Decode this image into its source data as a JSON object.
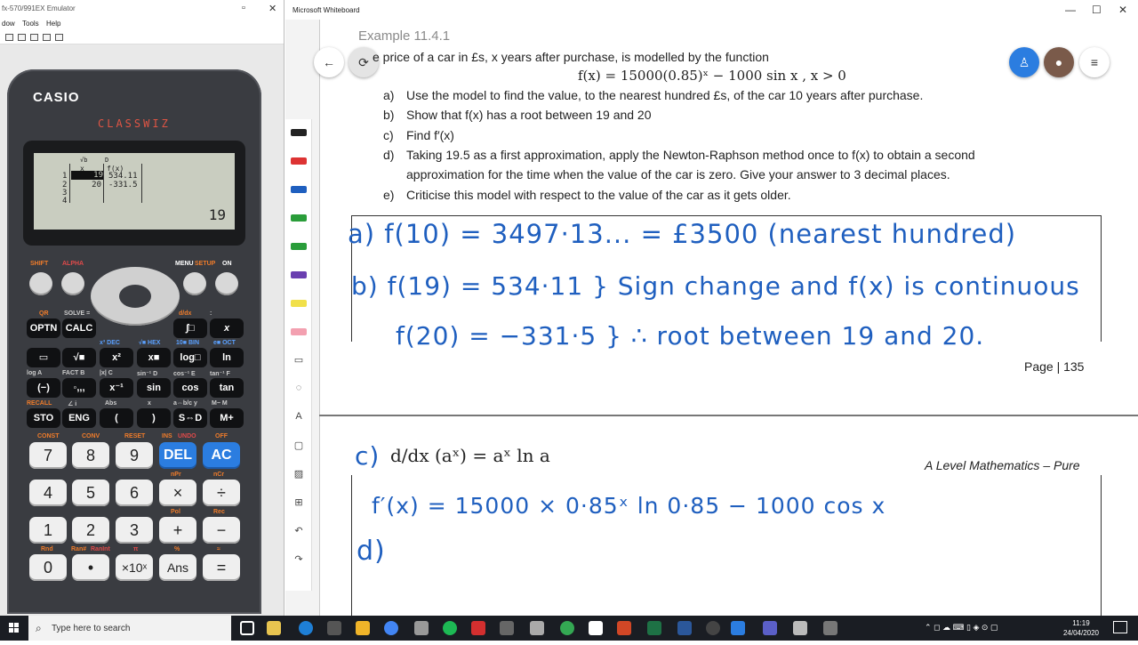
{
  "emulator": {
    "title": "fx-570/991EX Emulator",
    "menu": [
      "dow",
      "Tools",
      "Help"
    ],
    "brand": "CASIO",
    "model": "CLASSWIZ",
    "lcd": {
      "indicator": "√b",
      "indicator2": "D",
      "col_x": "x",
      "col_fx": "f(x)",
      "rows": [
        {
          "n": "1",
          "x": "19",
          "fx": "534.11"
        },
        {
          "n": "2",
          "x": "20",
          "fx": "-331.5"
        },
        {
          "n": "3",
          "x": "",
          "fx": ""
        },
        {
          "n": "4",
          "x": "",
          "fx": ""
        }
      ],
      "result": "19"
    },
    "function_labels": {
      "shift": "SHIFT",
      "alpha": "ALPHA",
      "menu": "MENU",
      "setup": "SETUP",
      "on": "ON"
    },
    "rows": [
      {
        "keys": [
          "OPTN",
          "CALC",
          "∫□",
          "x"
        ],
        "labels": [
          "QR",
          "SOLVE =",
          "d/dx",
          ":"
        ]
      },
      {
        "keys": [
          "▭",
          "√■",
          "x²",
          "x■",
          "log□",
          "ln"
        ],
        "labels": [
          "",
          "",
          "x³ DEC",
          "√■ HEX",
          "10■ BIN",
          "e■ OCT"
        ]
      },
      {
        "keys": [
          "(−)",
          "◦,,,",
          "x⁻¹",
          "sin",
          "cos",
          "tan"
        ],
        "labels": [
          "log A",
          "FACT B",
          "|x| C",
          "sin⁻¹ D",
          "cos⁻¹ E",
          "tan⁻¹ F"
        ]
      },
      {
        "keys": [
          "STO",
          "ENG",
          "(",
          ")",
          "S⇔D",
          "M+"
        ],
        "labels": [
          "RECALL",
          "∠ i",
          "Abs",
          "x",
          "a⇔b/c y",
          "M− M"
        ]
      }
    ],
    "numpad": [
      [
        "7",
        "8",
        "9",
        "DEL",
        "AC"
      ],
      [
        "4",
        "5",
        "6",
        "×",
        "÷"
      ],
      [
        "1",
        "2",
        "3",
        "+",
        "−"
      ],
      [
        "0",
        "•",
        "×10ˣ",
        "Ans",
        "="
      ]
    ],
    "numpad_labels": [
      [
        "CONST",
        "CONV",
        "RESET",
        "INS",
        "UNDO",
        "OFF"
      ],
      [
        "",
        "",
        "",
        "nPr",
        "nCr"
      ],
      [
        "",
        "",
        "",
        "Pol",
        "Rec"
      ],
      [
        "Rnd",
        "Ran#",
        "RanInt",
        "π",
        "%",
        "≈"
      ]
    ]
  },
  "whiteboard": {
    "title": "Microsoft Whiteboard",
    "example_title": "Example 11.4.1",
    "intro": "e price of a car in £s, x years after purchase, is modelled by the function",
    "function": "f(x) = 15000(0.85)ˣ − 1000 sin x ,       x > 0",
    "parts": [
      {
        "label": "a)",
        "text": "Use the model to find the value, to the nearest hundred £s, of the car 10 years after purchase."
      },
      {
        "label": "b)",
        "text": "Show that f(x) has a root between 19 and 20"
      },
      {
        "label": "c)",
        "text": "Find f′(x)"
      },
      {
        "label": "d)",
        "text": "Taking 19.5 as a first approximation, apply the Newton-Raphson method once to f(x) to obtain a second"
      },
      {
        "label": "",
        "text": "approximation for the time when the value of the car is zero. Give your answer to 3 decimal places."
      },
      {
        "label": "e)",
        "text": "Criticise this model with respect to the value of the car as it gets older."
      }
    ],
    "handwriting": {
      "a": "a)  f(10) = 3497·13...      =  £3500 (nearest hundred)",
      "b1": "b)  f(19) = 534·11 }  Sign change and f(x) is continuous",
      "b2": "f(20) = −331·5 }        ∴ root between 19 and 20.",
      "c_label": "c)",
      "c_formula": "d/dx (aˣ) = aˣ ln a",
      "c_answer": "f′(x) = 15000 × 0·85ˣ ln 0·85 − 1000 cos x",
      "d_label": "d)"
    },
    "page_number": "Page | 135",
    "footer": "A Level Mathematics – Pure"
  },
  "taskbar": {
    "search_placeholder": "Type here to search",
    "time": "11:19",
    "date": "24/04/2020"
  }
}
